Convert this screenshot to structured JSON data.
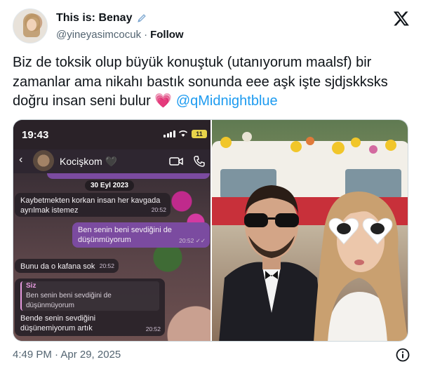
{
  "author": {
    "display_name": "This is: Benay",
    "handle": "@yineyasimcocuk",
    "separator": "·",
    "follow_label": "Follow"
  },
  "tweet": {
    "text": "Biz de toksik olup büyük konuştuk (utanıyorum maalsf) bir zamanlar  ama nikahı bastık sonunda eee aşk işte sjdjskksks doğru insan seni bulur 💗 ",
    "mention": "@qMidnightblue"
  },
  "chat": {
    "time": "19:43",
    "battery": "11",
    "contact": "Kocişkom 🖤",
    "date": "30 Eyl 2023",
    "messages": [
      {
        "direction": "in",
        "text": "Kaybetmekten korkan insan her kavgada ayrılmak istemez",
        "time": "20:52"
      },
      {
        "direction": "out",
        "text": "Ben senin beni sevdiğini de düşünmüyorum",
        "time": "20:52 ✓✓"
      },
      {
        "direction": "in",
        "text": "Bunu da o kafana sok",
        "time": "20:52"
      },
      {
        "direction": "in",
        "reply_name": "Siz",
        "reply_text": "Ben senin beni sevdiğini de düşünmüyorum",
        "text": "Bende senin sevdiğini düşünemiyorum artık",
        "time": "20:52"
      }
    ]
  },
  "footer": {
    "timestamp": "4:49 PM · Apr 29, 2025"
  },
  "icons": [
    "pen-icon",
    "x-logo-icon",
    "signal-icon",
    "wifi-icon",
    "battery-icon",
    "video-call-icon",
    "phone-icon",
    "info-icon"
  ],
  "colors": {
    "link": "#1d9bf0",
    "text": "#0f1419",
    "muted": "#536471",
    "chat_out": "#7b4ba0"
  }
}
